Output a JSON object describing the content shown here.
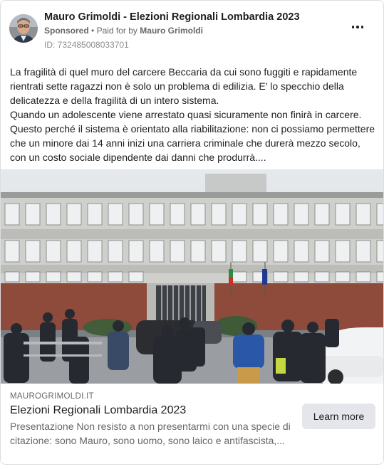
{
  "ad": {
    "advertiser_name": "Mauro Grimoldi - Elezioni Regionali Lombardia 2023",
    "sponsored_label": "Sponsored",
    "separator": "•",
    "paid_for_prefix": "Paid for by",
    "paid_for_name": "Mauro Grimoldi",
    "ad_id": "ID: 732485008033701",
    "more_icon": "more-horizontal-icon"
  },
  "body": {
    "paragraphs": [
      "La fragilità di quel muro del carcere Beccaria da cui sono fuggiti e rapidamente rientrati sette ragazzi non è solo un problema di edilizia. E’ lo specchio della delicatezza e della fragilità di un intero sistema.",
      "Quando un adolescente viene arrestato quasi sicuramente non finirà in carcere. Questo perché il sistema è orientato alla riabilitazione: non ci possiamo permettere che un minore dai 14 anni inizi una carriera criminale che durerà mezzo secolo, con un costo sociale dipendente dai danni che produrrà...."
    ]
  },
  "link": {
    "domain": "MAUROGRIMOLDI.IT",
    "title": "Elezioni Regionali Lombardia 2023",
    "description": "Presentazione Non resisto a non presentarmi con una specie di citazione: sono Mauro, sono uomo, sono laico e antifascista,...",
    "cta_label": "Learn more"
  },
  "colors": {
    "border": "#dadde1",
    "secondary_text": "#65676b",
    "button_bg": "#e4e6eb"
  }
}
